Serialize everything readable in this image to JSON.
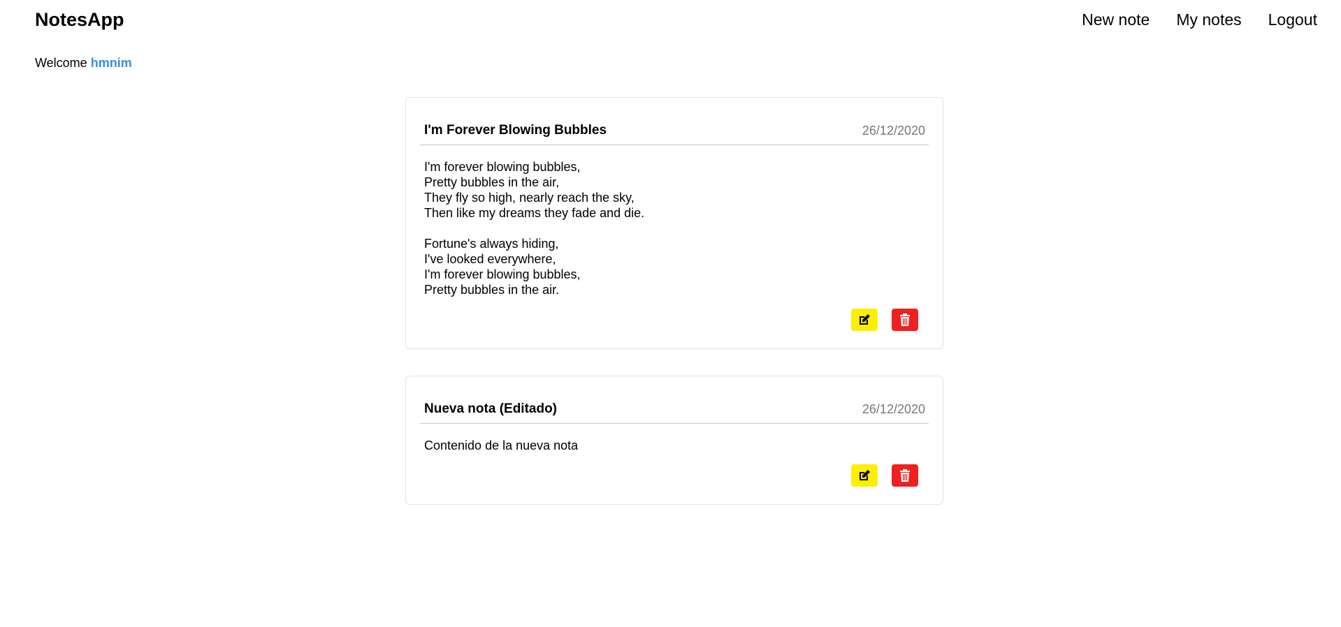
{
  "app": {
    "brand": "NotesApp"
  },
  "nav": {
    "items": [
      {
        "label": "New note"
      },
      {
        "label": "My notes"
      },
      {
        "label": "Logout"
      }
    ]
  },
  "welcome": {
    "prefix": "Welcome",
    "username": "hmnim",
    "username_color": "#3a8fd8"
  },
  "notes": [
    {
      "title": "I'm Forever Blowing Bubbles",
      "date": "26/12/2020",
      "content": "I'm forever blowing bubbles,\nPretty bubbles in the air,\nThey fly so high, nearly reach the sky,\nThen like my dreams they fade and die.\n\nFortune's always hiding,\nI've looked everywhere,\nI'm forever blowing bubbles,\nPretty bubbles in the air.",
      "edit_icon": "edit-icon",
      "delete_icon": "trash-icon"
    },
    {
      "title": "Nueva nota (Editado)",
      "date": "26/12/2020",
      "content": "Contenido de la nueva nota",
      "edit_icon": "edit-icon",
      "delete_icon": "trash-icon"
    }
  ],
  "colors": {
    "edit_button": "#ffee00",
    "delete_button": "#ee2020",
    "date_text": "#777777"
  }
}
